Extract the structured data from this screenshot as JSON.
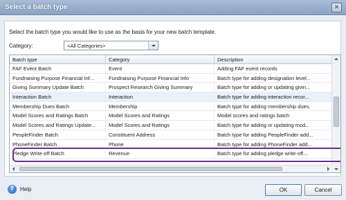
{
  "window": {
    "title": "Select a batch type",
    "close_glyph": "✕"
  },
  "instruction": "Select the batch type you would like to use as the basis for your new batch template.",
  "category": {
    "label": "Category:",
    "selected": "<All Categories>"
  },
  "table": {
    "columns": [
      "Batch type",
      "Category",
      "Description"
    ],
    "rows": [
      {
        "batch_type": "FAF Event Batch",
        "category": "Event",
        "description": "Adding FAF event records"
      },
      {
        "batch_type": "Fundraising Purpose Financial Inf...",
        "category": "Fundraising Purpose Financial Info",
        "description": "Batch type for adding designation level..."
      },
      {
        "batch_type": "Giving Summary Update Batch",
        "category": "Prospect Research Giving Summary",
        "description": "Batch type for adding or updating givin..."
      },
      {
        "batch_type": "Interaction Batch",
        "category": "Interaction",
        "description": "Batch type for adding interaction recor..."
      },
      {
        "batch_type": "Membership Dues Batch",
        "category": "Membership",
        "description": "Batch type for adding membership dues."
      },
      {
        "batch_type": "Model Scores and Ratings Batch",
        "category": "Model Scores and Ratings",
        "description": "Model scores and ratings batch"
      },
      {
        "batch_type": "Model Scores and Ratings Update...",
        "category": "Model Scores and Ratings",
        "description": "Batch type for adding or updating mod..."
      },
      {
        "batch_type": "PeopleFinder Batch",
        "category": "Constituent Address",
        "description": "Batch type for adding PeopleFinder add..."
      },
      {
        "batch_type": "PhoneFinder Batch",
        "category": "Phone",
        "description": "Batch type for adding PhoneFinder add..."
      },
      {
        "batch_type": "Pledge Write-off Batch",
        "category": "Revenue",
        "description": "Batch type for adding pledge write-off..."
      }
    ],
    "selected_row_index": 3
  },
  "footer": {
    "help_label": "Help",
    "help_glyph": "?",
    "ok_label": "OK",
    "cancel_label": "Cancel"
  },
  "colors": {
    "highlight_outline": "#6a2d93",
    "title_bar": "#8aa3c3"
  }
}
